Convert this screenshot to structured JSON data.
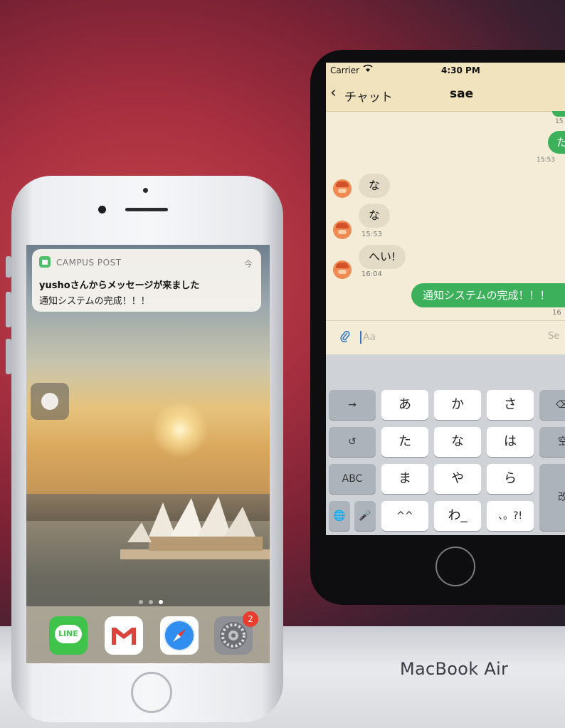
{
  "mac": {
    "brand_label": "MacBook Air"
  },
  "simulator": {
    "status": {
      "carrier": "Carrier",
      "wifi_icon": "wifi-icon",
      "time": "4:30 PM"
    },
    "nav": {
      "back_label": "チャット",
      "title": "sae"
    },
    "messages": [
      {
        "direction": "out",
        "text": "た",
        "time": "15:53"
      },
      {
        "direction": "in",
        "text": "な",
        "time": ""
      },
      {
        "direction": "in",
        "text": "な",
        "time": "15:53"
      },
      {
        "direction": "in",
        "text": "へい!",
        "time": "16:04"
      },
      {
        "direction": "out",
        "text": "通知システムの完成！！！",
        "time": "16"
      }
    ],
    "top_partial_time": "15",
    "input": {
      "placeholder": "Aa",
      "send_label": "Se"
    },
    "keyboard": {
      "row1": [
        "→",
        "あ",
        "か",
        "さ",
        "⌫"
      ],
      "row2": [
        "↺",
        "た",
        "な",
        "は",
        "空"
      ],
      "row3": [
        "ABC",
        "ま",
        "や",
        "ら",
        "改"
      ],
      "row4": [
        "🌐",
        "🎤",
        "^^",
        "わ_",
        "、。?!"
      ]
    }
  },
  "phone": {
    "notification": {
      "app_name": "CAMPUS POST",
      "time": "今",
      "title": "yushoさんからメッセージが来ました",
      "body": "通知システムの完成！！！"
    },
    "dock": {
      "apps": [
        {
          "name": "LINE",
          "label": "LINE"
        },
        {
          "name": "Gmail",
          "label": ""
        },
        {
          "name": "Safari",
          "label": ""
        },
        {
          "name": "Settings",
          "label": "",
          "badge": "2"
        }
      ]
    }
  },
  "colors": {
    "chat_green": "#3cb05a",
    "nav_bg": "#f1e3bd",
    "badge_red": "#ea3b2f"
  }
}
